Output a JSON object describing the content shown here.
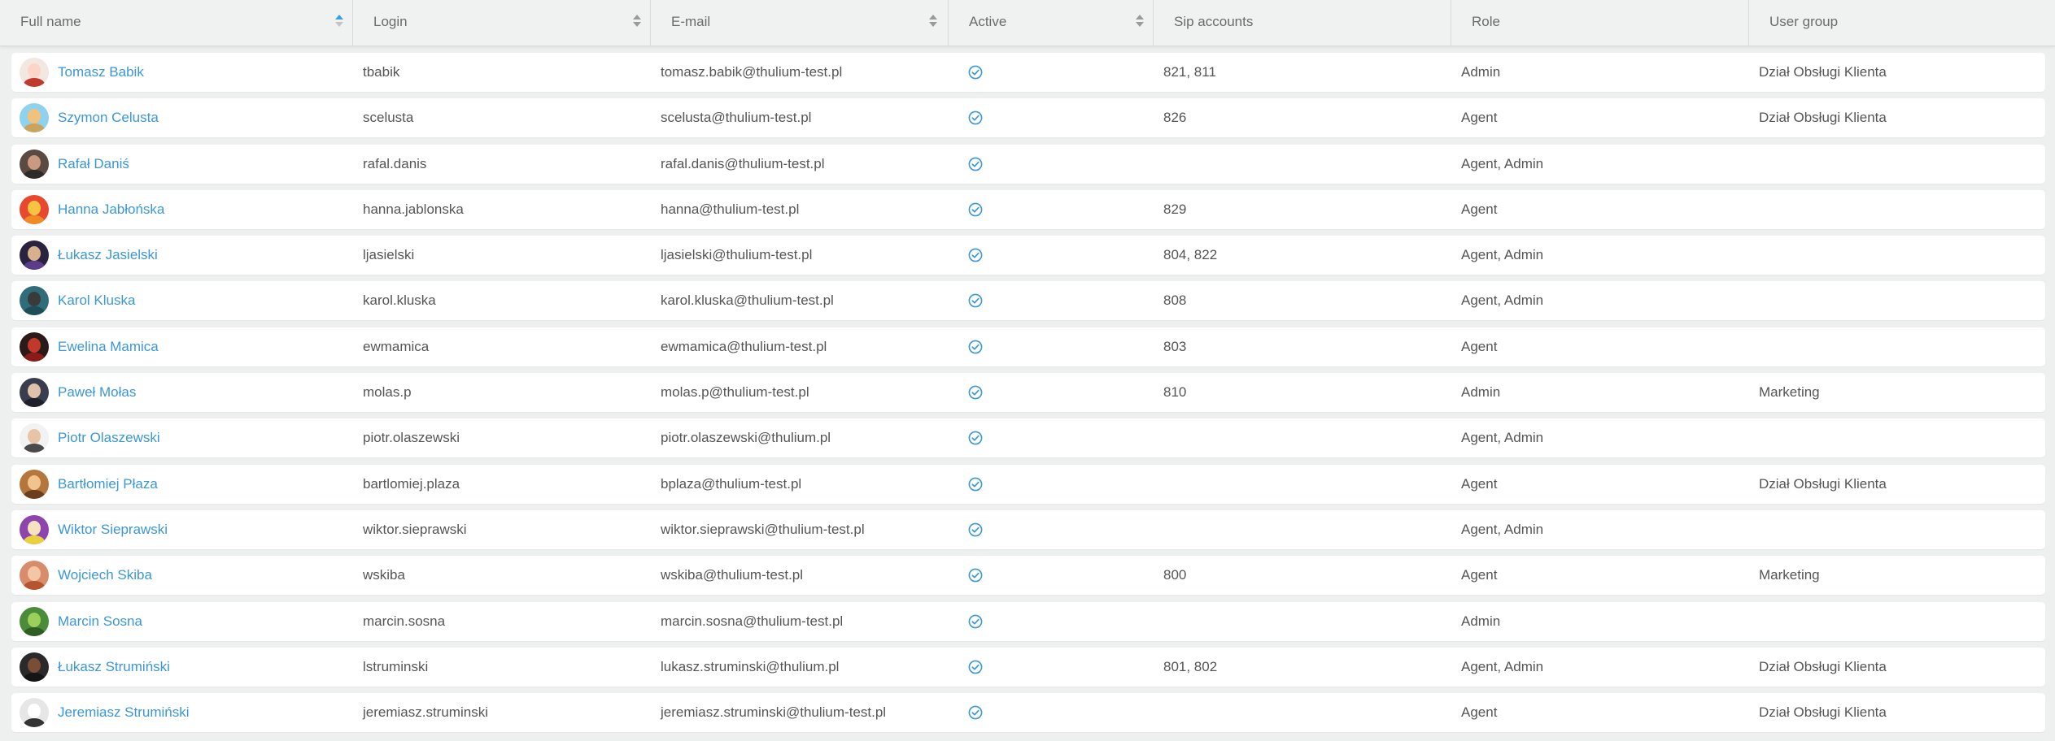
{
  "columns": [
    {
      "label": "Full name",
      "sort": "asc"
    },
    {
      "label": "Login",
      "sort": "both"
    },
    {
      "label": "E-mail",
      "sort": "both"
    },
    {
      "label": "Active",
      "sort": "both"
    },
    {
      "label": "Sip accounts",
      "sort": "none"
    },
    {
      "label": "Role",
      "sort": "none"
    },
    {
      "label": "User group",
      "sort": "none"
    }
  ],
  "accent_color": "#3b97d6",
  "active_icon": "check-circle-icon",
  "users": [
    {
      "full_name": "Tomasz Babik",
      "login": "tbabik",
      "email": "tomasz.babik@thulium-test.pl",
      "active": true,
      "sip": "821, 811",
      "role": "Admin",
      "group": "Dział Obsługi Klienta",
      "avatar": {
        "bg": "#f3e7e1",
        "head": "#fbd6c8",
        "body": "#c0392b"
      }
    },
    {
      "full_name": "Szymon Celusta",
      "login": "scelusta",
      "email": "scelusta@thulium-test.pl",
      "active": true,
      "sip": "826",
      "role": "Agent",
      "group": "Dział Obsługi Klienta",
      "avatar": {
        "bg": "#8fd2ee",
        "head": "#f2c27c",
        "body": "#c9a45e"
      }
    },
    {
      "full_name": "Rafał Daniś",
      "login": "rafal.danis",
      "email": "rafal.danis@thulium-test.pl",
      "active": true,
      "sip": "",
      "role": "Agent, Admin",
      "group": "",
      "avatar": {
        "bg": "#5a4a42",
        "head": "#c99a7f",
        "body": "#2e2a28"
      }
    },
    {
      "full_name": "Hanna Jabłońska",
      "login": "hanna.jablonska",
      "email": "hanna@thulium-test.pl",
      "active": true,
      "sip": "829",
      "role": "Agent",
      "group": "",
      "avatar": {
        "bg": "#e8482e",
        "head": "#f5c542",
        "body": "#f08a24"
      }
    },
    {
      "full_name": "Łukasz Jasielski",
      "login": "ljasielski",
      "email": "ljasielski@thulium-test.pl",
      "active": true,
      "sip": "804, 822",
      "role": "Agent, Admin",
      "group": "",
      "avatar": {
        "bg": "#2a2340",
        "head": "#d9b08c",
        "body": "#5a3b8c"
      }
    },
    {
      "full_name": "Karol Kluska",
      "login": "karol.kluska",
      "email": "karol.kluska@thulium-test.pl",
      "active": true,
      "sip": "808",
      "role": "Agent, Admin",
      "group": "",
      "avatar": {
        "bg": "#2f6d7a",
        "head": "#3a3a3a",
        "body": "#1f4d57"
      }
    },
    {
      "full_name": "Ewelina Mamica",
      "login": "ewmamica",
      "email": "ewmamica@thulium-test.pl",
      "active": true,
      "sip": "803",
      "role": "Agent",
      "group": "",
      "avatar": {
        "bg": "#2b1a1a",
        "head": "#c0392b",
        "body": "#8b1a1a"
      }
    },
    {
      "full_name": "Paweł Mołas",
      "login": "molas.p",
      "email": "molas.p@thulium-test.pl",
      "active": true,
      "sip": "810",
      "role": "Admin",
      "group": "Marketing",
      "avatar": {
        "bg": "#3a3d4f",
        "head": "#e0c2a8",
        "body": "#1d1f2b"
      }
    },
    {
      "full_name": "Piotr Olaszewski",
      "login": "piotr.olaszewski",
      "email": "piotr.olaszewski@thulium.pl",
      "active": true,
      "sip": "",
      "role": "Agent, Admin",
      "group": "",
      "avatar": {
        "bg": "#f2f2f2",
        "head": "#e8c4a6",
        "body": "#4a4a4a"
      }
    },
    {
      "full_name": "Bartłomiej Płaza",
      "login": "bartlomiej.plaza",
      "email": "bplaza@thulium-test.pl",
      "active": true,
      "sip": "",
      "role": "Agent",
      "group": "Dział Obsługi Klienta",
      "avatar": {
        "bg": "#b5763c",
        "head": "#f0c48f",
        "body": "#6b3e1c"
      }
    },
    {
      "full_name": "Wiktor Sieprawski",
      "login": "wiktor.sieprawski",
      "email": "wiktor.sieprawski@thulium-test.pl",
      "active": true,
      "sip": "",
      "role": "Agent, Admin",
      "group": "",
      "avatar": {
        "bg": "#8e44ad",
        "head": "#f4e3c1",
        "body": "#e8d13c"
      }
    },
    {
      "full_name": "Wojciech Skiba",
      "login": "wskiba",
      "email": "wskiba@thulium-test.pl",
      "active": true,
      "sip": "800",
      "role": "Agent",
      "group": "Marketing",
      "avatar": {
        "bg": "#d98c6b",
        "head": "#f3c7a5",
        "body": "#b5542f"
      }
    },
    {
      "full_name": "Marcin Sosna",
      "login": "marcin.sosna",
      "email": "marcin.sosna@thulium-test.pl",
      "active": true,
      "sip": "",
      "role": "Admin",
      "group": "",
      "avatar": {
        "bg": "#4a8c3a",
        "head": "#9bd05a",
        "body": "#2f5e24"
      }
    },
    {
      "full_name": "Łukasz Strumiński",
      "login": "lstruminski",
      "email": "lukasz.struminski@thulium.pl",
      "active": true,
      "sip": "801, 802",
      "role": "Agent, Admin",
      "group": "Dział Obsługi Klienta",
      "avatar": {
        "bg": "#2a2a2a",
        "head": "#7a4e35",
        "body": "#151515"
      }
    },
    {
      "full_name": "Jeremiasz Strumiński",
      "login": "jeremiasz.struminski",
      "email": "jeremiasz.struminski@thulium-test.pl",
      "active": true,
      "sip": "",
      "role": "Agent",
      "group": "Dział Obsługi Klienta",
      "avatar": {
        "bg": "#e6e6e6",
        "head": "#ffffff",
        "body": "#333333"
      }
    }
  ]
}
